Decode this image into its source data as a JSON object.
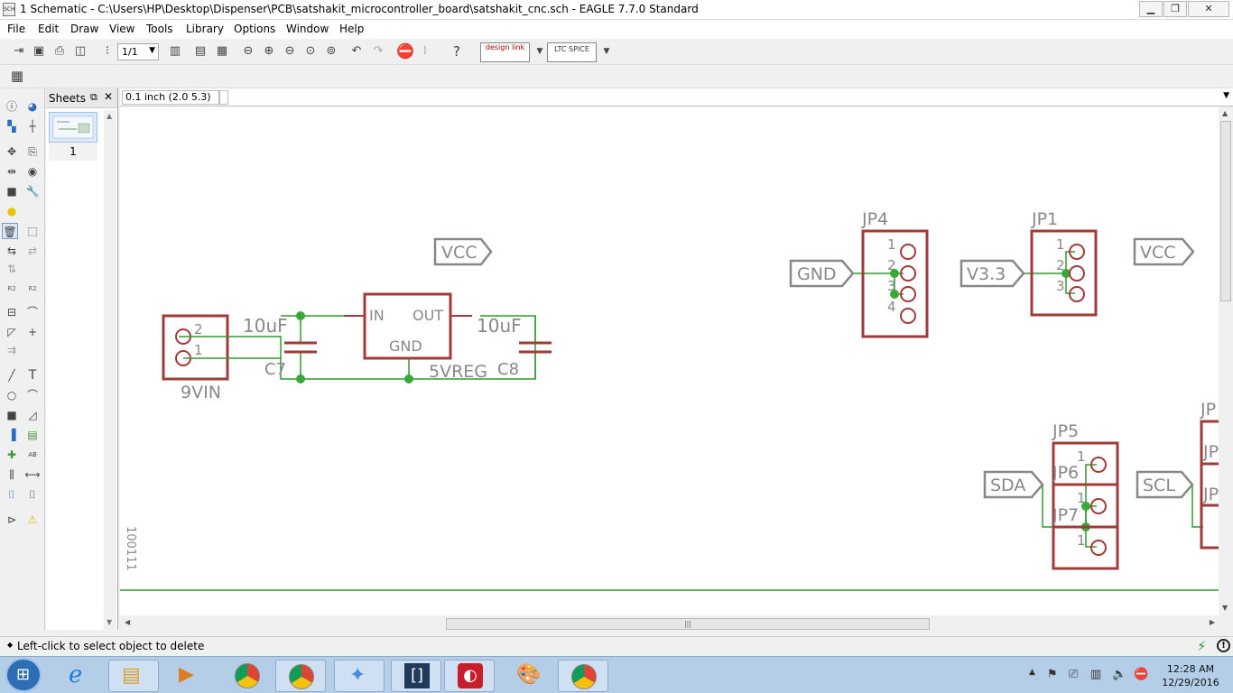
{
  "window": {
    "title": "1 Schematic - C:\\Users\\HP\\Desktop\\Dispenser\\PCB\\satshakit_microcontroller_board\\satshakit_cnc.sch - EAGLE 7.7.0 Standard",
    "minimize": "▁",
    "maximize": "❐",
    "close": "✕"
  },
  "menu": [
    "File",
    "Edit",
    "Draw",
    "View",
    "Tools",
    "Library",
    "Options",
    "Window",
    "Help"
  ],
  "toolbar": {
    "sheet_select": "1/1",
    "designlink_label": "design link",
    "ltspice_label": "LTC SPICE"
  },
  "sheets_panel": {
    "title": "Sheets",
    "sheet_label": "1"
  },
  "coord_readout": "0.1 inch (2.0 5.3)",
  "schematic": {
    "connector_9vin": {
      "name": "9VIN",
      "pin2": "2",
      "pin1": "1"
    },
    "cap_c7": {
      "value": "10uF",
      "name": "C7"
    },
    "regulator": {
      "in": "IN",
      "out": "OUT",
      "gnd": "GND",
      "name": "5VREG"
    },
    "cap_c8": {
      "value": "10uF",
      "name": "C8"
    },
    "vcc_label_1": "VCC",
    "gnd_label": "GND",
    "jp4": {
      "name": "JP4",
      "pins": [
        "1",
        "2",
        "3",
        "4"
      ]
    },
    "v33_label": "V3.3",
    "jp1": {
      "name": "JP1",
      "pins": [
        "1",
        "2",
        "3"
      ]
    },
    "vcc_label_2": "VCC",
    "sda_label": "SDA",
    "scl_label": "SCL",
    "jp5": {
      "name": "JP5",
      "pin": "1"
    },
    "jp6": {
      "name": "JP6",
      "pin": "1"
    },
    "jp7": {
      "name": "JP7",
      "pin": "1"
    },
    "jp_right_partial": "JP",
    "frame_text": "100111"
  },
  "status_text": "Left-click to select object to delete",
  "taskbar": {
    "time": "12:28 AM",
    "date": "12/29/2016"
  },
  "colors": {
    "part_outline": "#a33a3a",
    "net_wire": "#2e9a2e",
    "junction": "#38a838",
    "label_gray": "#888888",
    "taskbar_bg": "#b5cee8"
  }
}
